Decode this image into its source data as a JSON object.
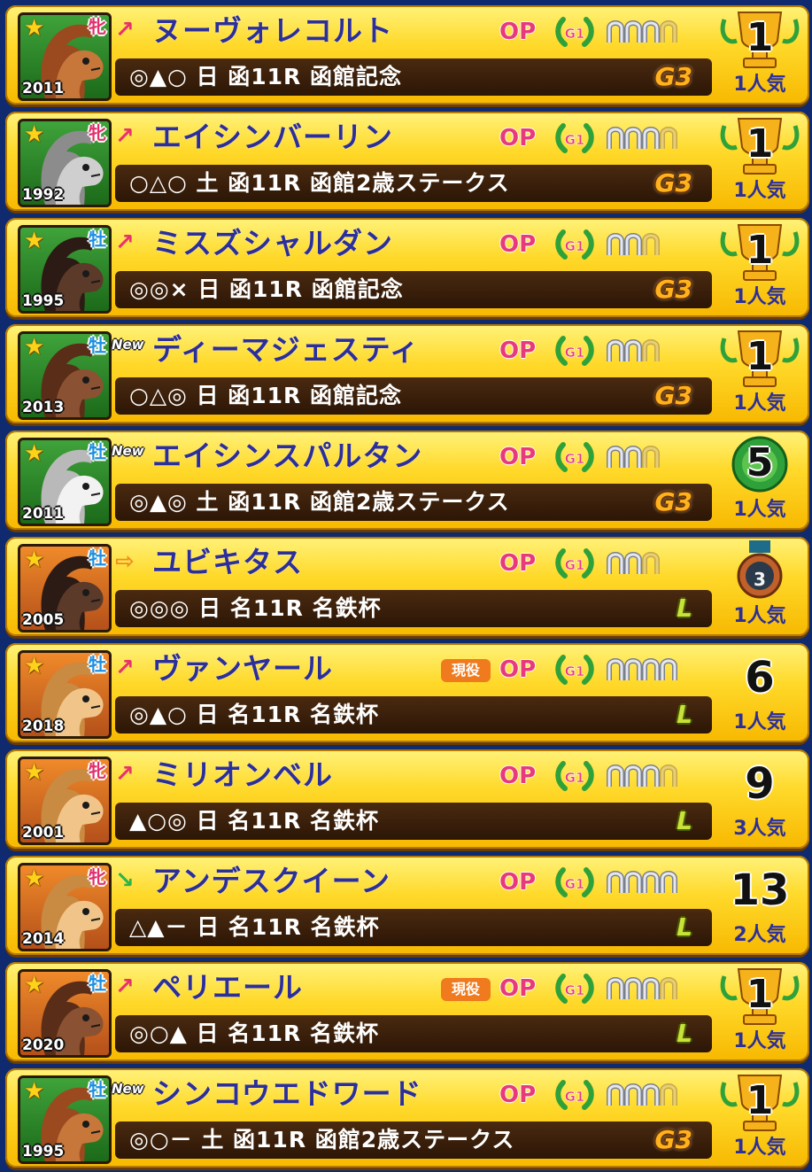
{
  "colors": {
    "accent_op": "#e83a7a",
    "name": "#2c2f9a",
    "trend_up": "#e8336a",
    "trend_down": "#2bb54a",
    "trend_flat": "#f08c1e"
  },
  "horses": [
    {
      "name": "ヌーヴォレコルト",
      "sex": "牝",
      "sex_type": "female",
      "year": "2011",
      "portrait": "green",
      "horse_color": "chestnut",
      "trend": "up",
      "trend_icon": "↗",
      "is_new": false,
      "new_label": "",
      "badge": "",
      "op": "OP",
      "g1": "G1",
      "shoes": 3,
      "info": "◎▲○ 日 函11R 函館記念",
      "grade": "G3",
      "grade_type": "g3",
      "rank": "1",
      "rank_type": "trophy",
      "popularity": "1人気"
    },
    {
      "name": "エイシンバーリン",
      "sex": "牝",
      "sex_type": "female",
      "year": "1992",
      "portrait": "green",
      "horse_color": "grey",
      "trend": "up",
      "trend_icon": "↗",
      "is_new": false,
      "new_label": "",
      "badge": "",
      "op": "OP",
      "g1": "G1",
      "shoes": 3,
      "info": "○△○ 土 函11R 函館2歳ステークス",
      "grade": "G3",
      "grade_type": "g3",
      "rank": "1",
      "rank_type": "trophy",
      "popularity": "1人気"
    },
    {
      "name": "ミスズシャルダン",
      "sex": "牡",
      "sex_type": "male",
      "year": "1995",
      "portrait": "green",
      "horse_color": "dark",
      "trend": "up",
      "trend_icon": "↗",
      "is_new": false,
      "new_label": "",
      "badge": "",
      "op": "OP",
      "g1": "G1",
      "shoes": 2,
      "info": "◎◎× 日 函11R 函館記念",
      "grade": "G3",
      "grade_type": "g3",
      "rank": "1",
      "rank_type": "trophy",
      "popularity": "1人気"
    },
    {
      "name": "ディーマジェスティ",
      "sex": "牡",
      "sex_type": "male",
      "year": "2013",
      "portrait": "green",
      "horse_color": "brown",
      "trend": "none",
      "trend_icon": "",
      "is_new": true,
      "new_label": "New",
      "badge": "",
      "op": "OP",
      "g1": "G1",
      "shoes": 2,
      "info": "○△◎ 日 函11R 函館記念",
      "grade": "G3",
      "grade_type": "g3",
      "rank": "1",
      "rank_type": "trophy",
      "popularity": "1人気"
    },
    {
      "name": "エイシンスパルタン",
      "sex": "牡",
      "sex_type": "male",
      "year": "2011",
      "portrait": "green",
      "horse_color": "white",
      "trend": "none",
      "trend_icon": "",
      "is_new": true,
      "new_label": "New",
      "badge": "",
      "op": "OP",
      "g1": "G1",
      "shoes": 2,
      "info": "◎▲◎ 土 函11R 函館2歳ステークス",
      "grade": "G3",
      "grade_type": "g3",
      "rank": "5",
      "rank_type": "wreath",
      "popularity": "1人気"
    },
    {
      "name": "ユビキタス",
      "sex": "牡",
      "sex_type": "male",
      "year": "2005",
      "portrait": "orange",
      "horse_color": "dark",
      "trend": "flat",
      "trend_icon": "⇨",
      "is_new": false,
      "new_label": "",
      "badge": "",
      "op": "OP",
      "g1": "G1",
      "shoes": 2,
      "info": "◎◎◎ 日 名11R 名鉄杯",
      "grade": "L",
      "grade_type": "l",
      "rank": "3",
      "rank_type": "medal",
      "popularity": "1人気"
    },
    {
      "name": "ヴァンヤール",
      "sex": "牡",
      "sex_type": "male",
      "year": "2018",
      "portrait": "orange",
      "horse_color": "light",
      "trend": "up",
      "trend_icon": "↗",
      "is_new": false,
      "new_label": "",
      "badge": "現役",
      "op": "OP",
      "g1": "G1",
      "shoes": 4,
      "info": "◎▲○ 日 名11R 名鉄杯",
      "grade": "L",
      "grade_type": "l",
      "rank": "6",
      "rank_type": "plain",
      "popularity": "1人気"
    },
    {
      "name": "ミリオンベル",
      "sex": "牝",
      "sex_type": "female",
      "year": "2001",
      "portrait": "orange",
      "horse_color": "light",
      "trend": "up",
      "trend_icon": "↗",
      "is_new": false,
      "new_label": "",
      "badge": "",
      "op": "OP",
      "g1": "G1",
      "shoes": 3,
      "info": "▲○◎ 日 名11R 名鉄杯",
      "grade": "L",
      "grade_type": "l",
      "rank": "9",
      "rank_type": "plain",
      "popularity": "3人気"
    },
    {
      "name": "アンデスクイーン",
      "sex": "牝",
      "sex_type": "female",
      "year": "2014",
      "portrait": "orange",
      "horse_color": "light",
      "trend": "down",
      "trend_icon": "↘",
      "is_new": false,
      "new_label": "",
      "badge": "",
      "op": "OP",
      "g1": "G1",
      "shoes": 4,
      "info": "△▲－ 日 名11R 名鉄杯",
      "grade": "L",
      "grade_type": "l",
      "rank": "13",
      "rank_type": "plain",
      "popularity": "2人気"
    },
    {
      "name": "ペリエール",
      "sex": "牡",
      "sex_type": "male",
      "year": "2020",
      "portrait": "orange",
      "horse_color": "brown",
      "trend": "up",
      "trend_icon": "↗",
      "is_new": false,
      "new_label": "",
      "badge": "現役",
      "op": "OP",
      "g1": "G1",
      "shoes": 3,
      "info": "◎○▲ 日 名11R 名鉄杯",
      "grade": "L",
      "grade_type": "l",
      "rank": "1",
      "rank_type": "trophy",
      "popularity": "1人気"
    },
    {
      "name": "シンコウエドワード",
      "sex": "牡",
      "sex_type": "male",
      "year": "1995",
      "portrait": "green",
      "horse_color": "chestnut",
      "trend": "none",
      "trend_icon": "",
      "is_new": true,
      "new_label": "New",
      "badge": "",
      "op": "OP",
      "g1": "G1",
      "shoes": 3,
      "info": "◎○－ 土 函11R 函館2歳ステークス",
      "grade": "G3",
      "grade_type": "g3",
      "rank": "1",
      "rank_type": "trophy",
      "popularity": "1人気"
    }
  ]
}
